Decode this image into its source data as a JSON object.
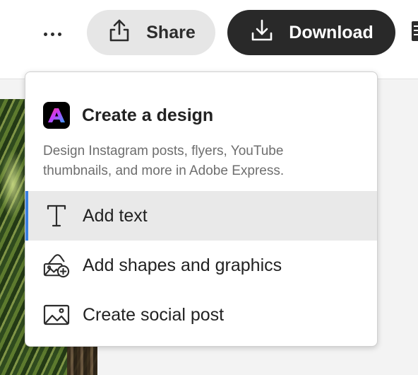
{
  "toolbar": {
    "more_icon": "more-horizontal-icon",
    "share_label": "Share",
    "share_icon": "share-upload-icon",
    "download_label": "Download",
    "download_icon": "download-icon"
  },
  "menu": {
    "title": "Create a design",
    "logo_icon": "adobe-express-logo",
    "description": "Design Instagram posts, flyers, YouTube thumbnails, and more in Adobe Express.",
    "items": [
      {
        "label": "Add text",
        "icon": "text-icon",
        "active": true
      },
      {
        "label": "Add shapes and graphics",
        "icon": "shapes-add-icon",
        "active": false
      },
      {
        "label": "Create social post",
        "icon": "image-icon",
        "active": false
      }
    ]
  },
  "colors": {
    "active_indicator": "#3a7fe0",
    "download_bg": "#292929",
    "share_bg": "#e6e6e6",
    "active_item_bg": "#e9e9e9"
  }
}
